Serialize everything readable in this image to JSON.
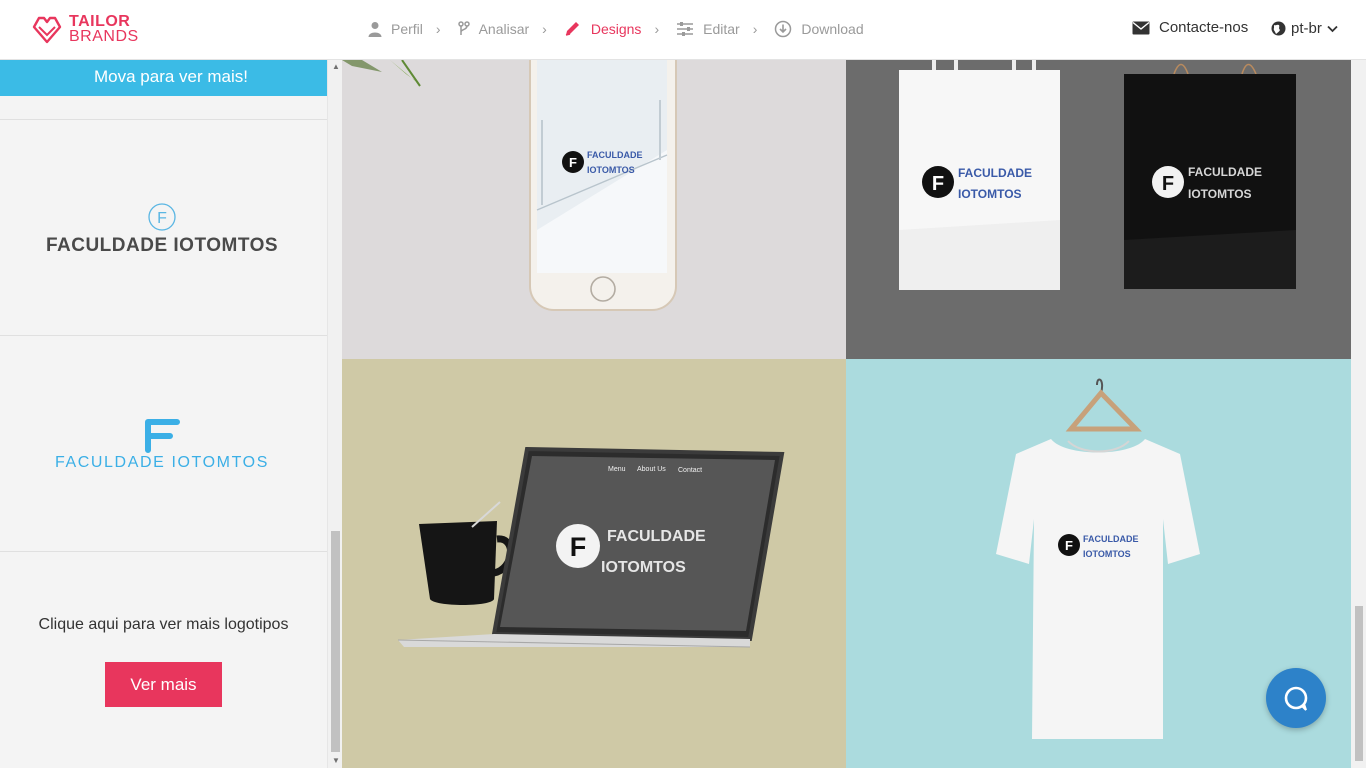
{
  "brand": {
    "line1": "TAILOR",
    "line2": "BRANDS"
  },
  "steps": [
    {
      "label": "Perfil",
      "icon": "user-icon",
      "active": false
    },
    {
      "label": "Analisar",
      "icon": "branch-icon",
      "active": false
    },
    {
      "label": "Designs",
      "icon": "pencil-icon",
      "active": true
    },
    {
      "label": "Editar",
      "icon": "sliders-icon",
      "active": false
    },
    {
      "label": "Download",
      "icon": "download-icon",
      "active": false
    }
  ],
  "header": {
    "contact_label": "Contacte-nos",
    "language": "pt-br"
  },
  "sidebar": {
    "banner": "Mova para ver mais!",
    "logos": [
      {
        "mark": "F",
        "name": "FACULDADE IOTOMTOS"
      },
      {
        "mark": "F",
        "name": "FACULDADE IOTOMTOS"
      }
    ],
    "more_text": "Clique aqui para ver mais logotipos",
    "more_button": "Ver mais"
  },
  "mockups": {
    "brand_line1": "FACULDADE",
    "brand_line2": "IOTOMTOS",
    "mark": "F",
    "laptop_menu": [
      "Menu",
      "About Us",
      "Contact"
    ]
  },
  "colors": {
    "accent": "#e8365d",
    "banner": "#3bbbe6",
    "chat": "#2d82c9"
  }
}
